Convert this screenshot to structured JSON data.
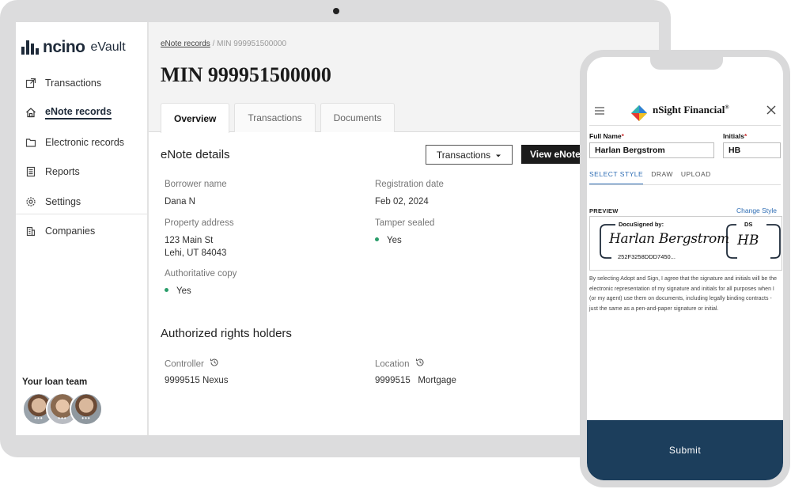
{
  "laptop": {
    "brand": {
      "name": "ncino",
      "product": "eVault"
    },
    "sidebar": {
      "items": [
        {
          "label": "Transactions",
          "icon": "external-link-icon",
          "active": false
        },
        {
          "label": "eNote records",
          "icon": "house-icon",
          "active": true
        },
        {
          "label": "Electronic records",
          "icon": "folder-icon",
          "active": false
        },
        {
          "label": "Reports",
          "icon": "report-icon",
          "active": false
        },
        {
          "label": "Settings",
          "icon": "gear-icon",
          "active": false
        },
        {
          "label": "Companies",
          "icon": "building-icon",
          "active": false
        }
      ],
      "loan_team_label": "Your loan team"
    },
    "breadcrumb": {
      "link": "eNote records",
      "separator": " / ",
      "current": "MIN 999951500000"
    },
    "page_title": "MIN 999951500000",
    "tabs": [
      "Overview",
      "Transactions",
      "Documents"
    ],
    "active_tab": "Overview",
    "enote_details": {
      "title": "eNote details",
      "transactions_button": "Transactions",
      "view_button": "View eNote",
      "fields": {
        "borrower_name": {
          "label": "Borrower name",
          "value": "Dana N"
        },
        "registration_date": {
          "label": "Registration date",
          "value": "Feb 02, 2024"
        },
        "property_address": {
          "label": "Property address",
          "line1": "123 Main St",
          "line2": "Lehi, UT 84043"
        },
        "tamper_sealed": {
          "label": "Tamper sealed",
          "value": "Yes"
        },
        "authoritative_copy": {
          "label": "Authoritative copy",
          "value": "Yes"
        }
      }
    },
    "rights_holders": {
      "title": "Authorized rights holders",
      "controller": {
        "label": "Controller",
        "value": "9999515 Nexus"
      },
      "location": {
        "label": "Location",
        "value": "9999515   Mortgage"
      }
    }
  },
  "phone": {
    "brand": "nSight Financial",
    "brand_mark": "®",
    "full_name": {
      "label": "Full Name",
      "required_mark": "*",
      "value": "Harlan Bergstrom"
    },
    "initials": {
      "label": "Initials",
      "required_mark": "*",
      "value": "HB"
    },
    "style_tabs": [
      "SELECT STYLE",
      "DRAW",
      "UPLOAD"
    ],
    "active_style_tab": "SELECT STYLE",
    "preview_label": "PREVIEW",
    "change_style": "Change Style",
    "signature": {
      "docusigned_label": "DocuSigned by:",
      "signature_text": "Harlan Bergstrom",
      "signature_id": "252F3258DDD7450...",
      "ds_label": "DS",
      "initials_text": "HB"
    },
    "legal_text": "By selecting Adopt and Sign, I agree that the signature and initials will be the electronic representation of my signature and initials for all purposes when I (or my agent) use them on documents, including legally binding contracts - just the same as a pen-and-paper signature or initial.",
    "submit_label": "Submit"
  },
  "colors": {
    "brand_navy": "#1f2b3a",
    "status_green": "#2a9d6a",
    "link_blue": "#2e6db4",
    "submit_bg": "#1c3e5c"
  }
}
